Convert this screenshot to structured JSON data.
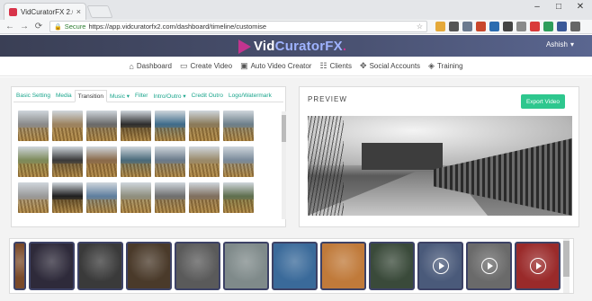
{
  "browser": {
    "tab_title": "VidCuratorFX 2.0",
    "tab_close": "×",
    "window_controls": [
      "–",
      "□",
      "✕"
    ],
    "nav_back": "←",
    "nav_forward": "→",
    "nav_reload": "⟳",
    "secure_label": "Secure",
    "url": "https://app.vidcuratorfx2.com/dashboard/timeline/customise",
    "extension_colors": [
      "#e5a93a",
      "#555555",
      "#6b7a8f",
      "#c9472c",
      "#2b6cb0",
      "#444444",
      "#8a8a8a",
      "#d93a3a",
      "#2f9e5b",
      "#3b5998",
      "#666666"
    ]
  },
  "app": {
    "logo_text_1": "Vid",
    "logo_text_2": "CuratorFX",
    "logo_dot": ".",
    "user_name": "Ashish",
    "user_caret": "▾",
    "brand_color": "#c2348f",
    "accent_color": "#2ec78e"
  },
  "nav": [
    {
      "label": "Dashboard",
      "icon": "home-icon",
      "glyph": "⌂"
    },
    {
      "label": "Create Video",
      "icon": "monitor-icon",
      "glyph": "▭"
    },
    {
      "label": "Auto Video Creator",
      "icon": "tv-icon",
      "glyph": "▣"
    },
    {
      "label": "Clients",
      "icon": "clients-icon",
      "glyph": "☷"
    },
    {
      "label": "Social Accounts",
      "icon": "social-icon",
      "glyph": "✥"
    },
    {
      "label": "Training",
      "icon": "training-icon",
      "glyph": "◈"
    }
  ],
  "editor": {
    "tabs": [
      "Basic Setting",
      "Media",
      "Transition",
      "Music ▾",
      "Filter",
      "Intro/Outro ▾",
      "Credit Outro",
      "Logo/Watermark"
    ],
    "active_tab": "Transition",
    "transition_thumbs": [
      "#8a8a8a",
      "#9c8360",
      "#6a6a6a",
      "#2d2d2d",
      "#3f6b8a",
      "#8a7a5a",
      "#6d7f8a",
      "#7d8a5a",
      "#3a3a3a",
      "#8a6a4a",
      "#4a6a7a",
      "#6a7a8a",
      "#9a8a6a",
      "#7a8a9a",
      "#9a9a9a",
      "#1f1f1f",
      "#5f7f9f",
      "#8f8f7f",
      "#6f6f6f",
      "#7f6f5f",
      "#5f6f4f"
    ]
  },
  "preview": {
    "title": "PREVIEW",
    "export_label": "Export Video"
  },
  "clips": [
    {
      "bg": "#7a4a2a",
      "play": false
    },
    {
      "bg": "#2e2a3a",
      "play": false
    },
    {
      "bg": "#3a3a3a",
      "play": false
    },
    {
      "bg": "#4a3a2a",
      "play": false
    },
    {
      "bg": "#5a5a5a",
      "play": false
    },
    {
      "bg": "#7f8a8a",
      "play": false
    },
    {
      "bg": "#3a6a9a",
      "play": false
    },
    {
      "bg": "#c07a3a",
      "play": false
    },
    {
      "bg": "#3a4a3a",
      "play": false
    },
    {
      "bg": "#4a5a7a",
      "play": true
    },
    {
      "bg": "#6a6a6a",
      "play": true
    },
    {
      "bg": "#9a2a2a",
      "play": true
    }
  ]
}
